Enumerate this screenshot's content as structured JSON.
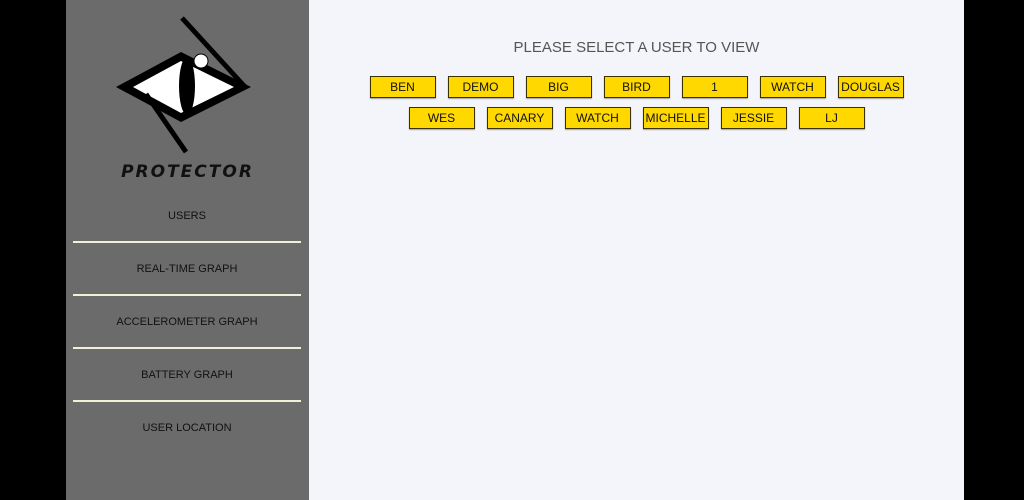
{
  "brand": {
    "name": "PROTECTOR"
  },
  "nav": [
    {
      "label": "USERS"
    },
    {
      "label": "REAL-TIME GRAPH"
    },
    {
      "label": "ACCELEROMETER GRAPH"
    },
    {
      "label": "BATTERY GRAPH"
    },
    {
      "label": "USER LOCATION"
    }
  ],
  "main": {
    "heading": "PLEASE SELECT A USER TO VIEW",
    "users": [
      "BEN",
      "DEMO",
      "BIG",
      "BIRD",
      "1",
      "WATCH",
      "DOUGLAS",
      "WES",
      "CANARY",
      "WATCH",
      "MICHELLE",
      "JESSIE",
      "LJ"
    ]
  },
  "colors": {
    "sidebar": "#6b6b6b",
    "main_bg": "#f4f5fa",
    "button": "#ffd800",
    "divider": "#f3f0d8"
  }
}
